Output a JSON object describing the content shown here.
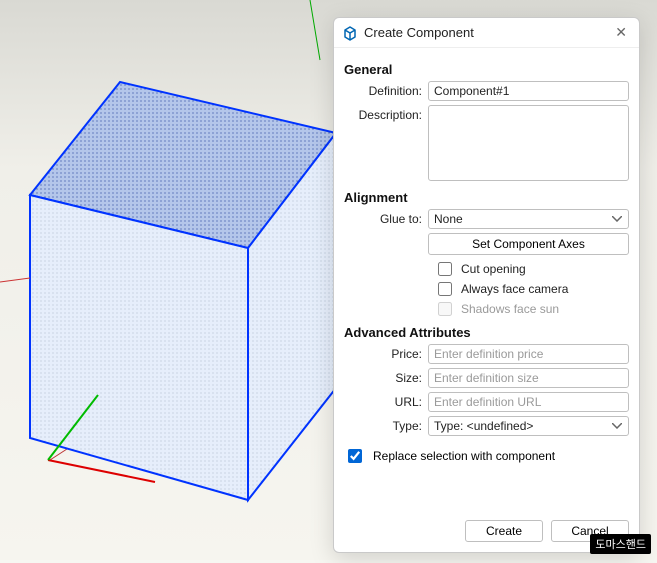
{
  "dialog": {
    "title": "Create Component",
    "sections": {
      "general": {
        "header": "General",
        "definition_label": "Definition:",
        "definition_value": "Component#1",
        "description_label": "Description:",
        "description_value": ""
      },
      "alignment": {
        "header": "Alignment",
        "glue_to_label": "Glue to:",
        "glue_to_value": "None",
        "set_axes_button": "Set Component Axes",
        "cut_opening_label": "Cut opening",
        "cut_opening_checked": false,
        "always_face_label": "Always face camera",
        "always_face_checked": false,
        "shadows_label": "Shadows face sun",
        "shadows_checked": false
      },
      "advanced": {
        "header": "Advanced Attributes",
        "price_label": "Price:",
        "price_placeholder": "Enter definition price",
        "size_label": "Size:",
        "size_placeholder": "Enter definition size",
        "url_label": "URL:",
        "url_placeholder": "Enter definition URL",
        "type_label": "Type:",
        "type_value": "Type: <undefined>"
      }
    },
    "replace_label": "Replace selection with component",
    "replace_checked": true,
    "create_button": "Create",
    "cancel_button": "Cancel"
  },
  "watermark": "도마스핸드",
  "viewport": {
    "axes": {
      "x_color": "#cc0000",
      "y_color": "#00a000",
      "z_color": "#0000cc"
    },
    "box": {
      "edge_color": "#0033ff",
      "face_top": "#a6bce6",
      "face_front": "#eef2fb",
      "face_side": "#e6e9f5"
    }
  }
}
